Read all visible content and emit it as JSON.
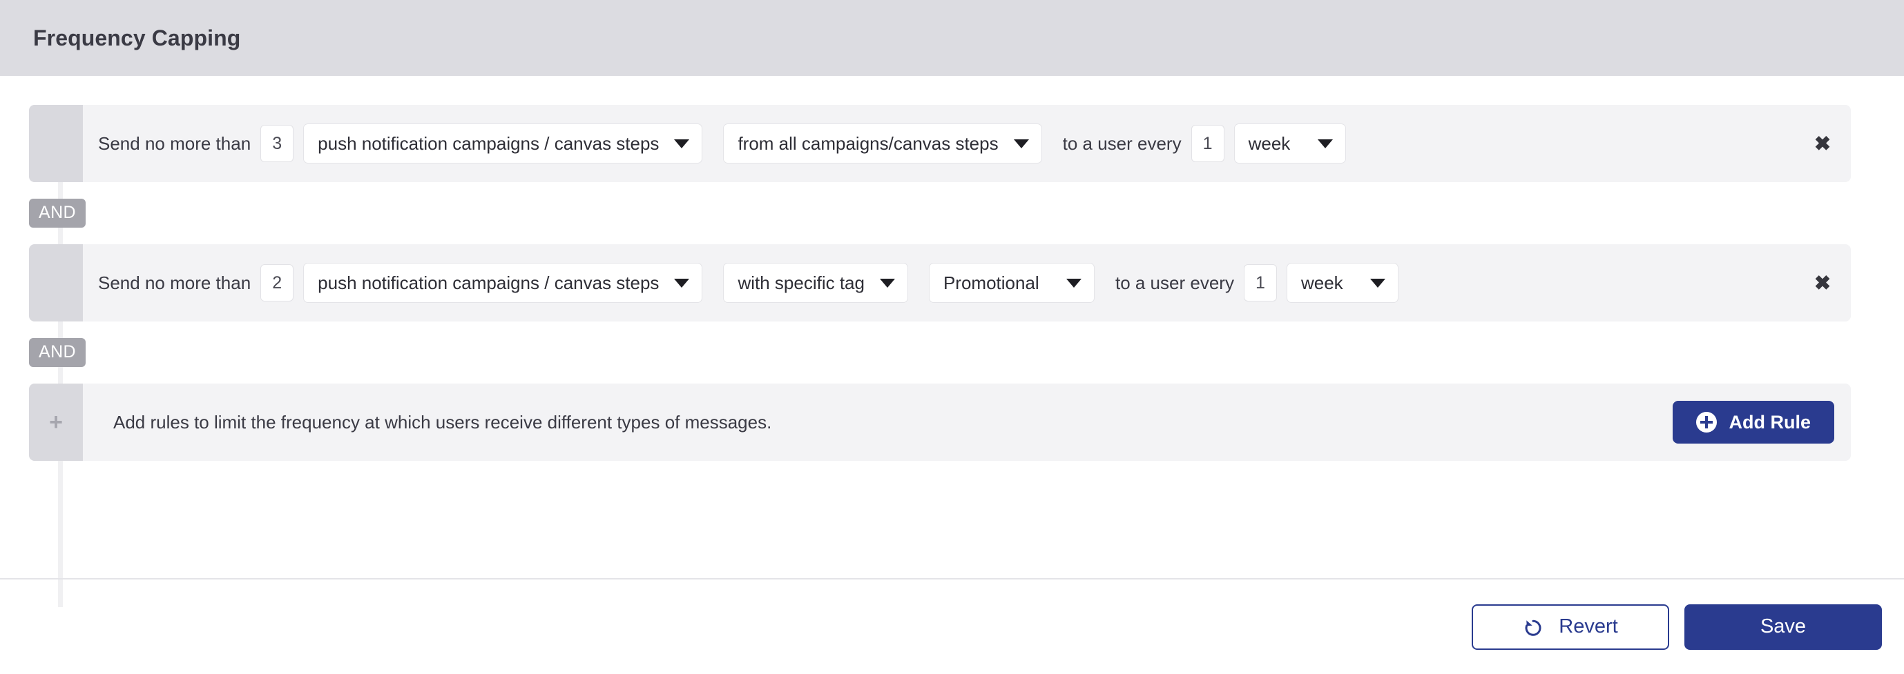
{
  "header": {
    "title": "Frequency Capping",
    "background_color": "#dcdce1"
  },
  "theme": {
    "accent_color": "#2a3b8f",
    "row_background": "#f3f3f5",
    "gutter_color": "#d9d9de",
    "and_badge_color": "#a4a4ab"
  },
  "rules": [
    {
      "prefix_label": "Send no more than",
      "count_value": "3",
      "message_type": "push notification campaigns / canvas steps",
      "scope": "from all campaigns/canvas steps",
      "tag": null,
      "every_label": "to a user every",
      "period_value": "1",
      "period_unit": "week",
      "remove_icon": "✖"
    },
    {
      "prefix_label": "Send no more than",
      "count_value": "2",
      "message_type": "push notification campaigns / canvas steps",
      "scope": "with specific tag",
      "tag": "Promotional",
      "every_label": "to a user every",
      "period_value": "1",
      "period_unit": "week",
      "remove_icon": "✖"
    }
  ],
  "connectors": [
    {
      "label": "AND"
    },
    {
      "label": "AND"
    }
  ],
  "add_row": {
    "plus_icon": "+",
    "description": "Add rules to limit the frequency at which users receive different types of messages.",
    "button_label": "Add Rule"
  },
  "footer": {
    "revert_label": "Revert",
    "save_label": "Save"
  }
}
